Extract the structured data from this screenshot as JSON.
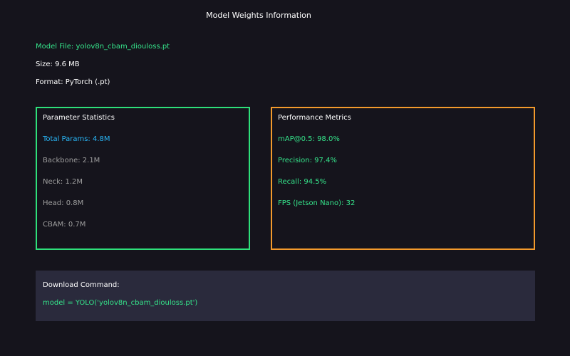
{
  "title": "Model Weights Information",
  "model_info": {
    "file": "Model File: yolov8n_cbam_diouloss.pt",
    "size": "Size: 9.6 MB",
    "format": "Format: PyTorch (.pt)"
  },
  "parameter_statistics": {
    "heading": "Parameter Statistics",
    "total": "Total Params: 4.8M",
    "rows": [
      "Backbone: 2.1M",
      "Neck: 1.2M",
      "Head: 0.8M",
      "CBAM: 0.7M"
    ]
  },
  "performance_metrics": {
    "heading": "Performance Metrics",
    "rows": [
      "mAP@0.5: 98.0%",
      "Precision: 97.4%",
      "Recall: 94.5%",
      "FPS (Jetson Nano): 32"
    ]
  },
  "download": {
    "label": "Download Command:",
    "code": "model = YOLO('yolov8n_cbam_diouloss.pt')"
  },
  "colors": {
    "background": "#15141c",
    "green_accent": "#2ee07a",
    "orange_accent": "#f39a2c",
    "blue_accent": "#29b6f6",
    "command_bg": "#2a2a3c"
  }
}
